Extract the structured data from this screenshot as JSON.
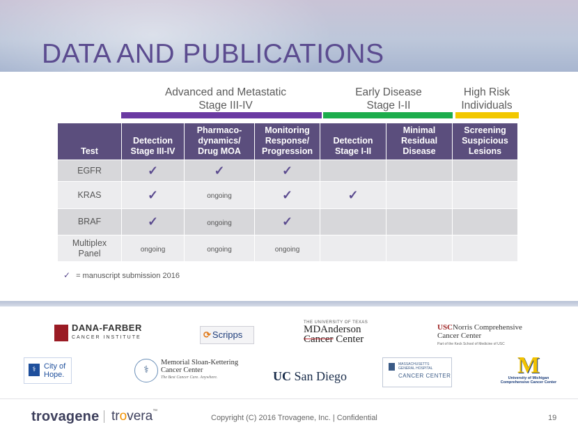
{
  "title": "DATA AND PUBLICATIONS",
  "groups": {
    "advanced": {
      "line1": "Advanced and Metastatic",
      "line2": "Stage III-IV",
      "color": "#6a3aa2"
    },
    "early": {
      "line1": "Early Disease",
      "line2": "Stage I-II",
      "color": "#1cad4c"
    },
    "risk": {
      "line1": "High Risk",
      "line2": "Individuals",
      "color": "#f2c800"
    }
  },
  "table": {
    "headers": [
      {
        "l1": "",
        "l2": "",
        "l3": "Test"
      },
      {
        "l1": "",
        "l2": "Detection",
        "l3": "Stage III-IV"
      },
      {
        "l1": "Pharmaco-",
        "l2": "dynamics/",
        "l3": "Drug MOA"
      },
      {
        "l1": "Monitoring",
        "l2": "Response/",
        "l3": "Progression"
      },
      {
        "l1": "",
        "l2": "Detection",
        "l3": "Stage I-II"
      },
      {
        "l1": "Minimal",
        "l2": "Residual",
        "l3": "Disease"
      },
      {
        "l1": "Screening",
        "l2": "Suspicious",
        "l3": "Lesions"
      }
    ],
    "rows": [
      {
        "label": "EGFR",
        "cells": [
          "✓",
          "✓",
          "✓",
          "",
          "",
          ""
        ]
      },
      {
        "label": "KRAS",
        "cells": [
          "✓",
          "ongoing",
          "✓",
          "✓",
          "",
          ""
        ]
      },
      {
        "label": "BRAF",
        "cells": [
          "✓",
          "ongoing",
          "✓",
          "",
          "",
          ""
        ]
      },
      {
        "label_l1": "Multiplex",
        "label_l2": "Panel",
        "cells": [
          "ongoing",
          "ongoing",
          "ongoing",
          "",
          "",
          ""
        ]
      }
    ]
  },
  "legend": {
    "mark": "✓",
    "text": "=  manuscript submission 2016"
  },
  "logos": {
    "dana_farber": {
      "name": "DANA-FARBER",
      "sub": "CANCER INSTITUTE"
    },
    "scripps": {
      "name": "Scripps"
    },
    "md_anderson": {
      "top": "THE UNIVERSITY OF TEXAS",
      "l1": "MDAnderson",
      "l2_a": "Cancer",
      "l2_b": " Center"
    },
    "usc": {
      "prefix": "USC",
      "l1": "Norris Comprehensive",
      "l2": "Cancer Center",
      "l3": "Part of the Keck School of Medicine of USC"
    },
    "city_of_hope": {
      "l1": "City of",
      "l2": "Hope."
    },
    "msk": {
      "l1": "Memorial Sloan-Kettering",
      "l2": "Cancer Center",
      "tag": "The Best Cancer Care. Anywhere."
    },
    "ucsd": {
      "a": "UC",
      "b": "San Diego"
    },
    "mgh": {
      "l1": "MASSACHUSETTS",
      "l2": "GENERAL HOSPITAL",
      "l3": "CANCER CENTER"
    },
    "umich": {
      "mark": "M",
      "l1": "University of Michigan",
      "l2": "Comprehensive Cancer Center"
    }
  },
  "footer": {
    "brand1": "trovagene",
    "brand2_a": "tr",
    "brand2_dot": "o",
    "brand2_b": "vera",
    "brand2_tm": "™",
    "copyright": "Copyright (C) 2016 Trovagene, Inc. | Confidential",
    "page": "19"
  }
}
